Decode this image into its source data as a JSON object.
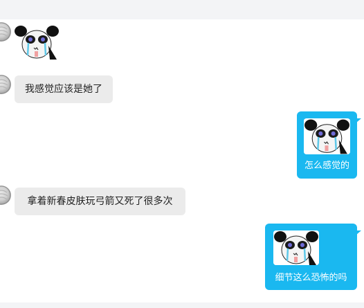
{
  "chat": {
    "messages": [
      {
        "direction": "incoming",
        "type": "sticker",
        "sticker_icon": "crying-panda-sticker"
      },
      {
        "direction": "incoming",
        "type": "text",
        "text": "我感觉应该是她了"
      },
      {
        "direction": "outgoing",
        "type": "sticker_caption",
        "sticker_icon": "crying-panda-sticker",
        "text": "怎么感觉的"
      },
      {
        "direction": "incoming",
        "type": "text",
        "text": "拿着新春皮肤玩弓箭又死了很多次"
      },
      {
        "direction": "outgoing",
        "type": "sticker_caption",
        "sticker_icon": "crying-panda-sticker",
        "text": "细节这么恐怖的吗"
      }
    ]
  },
  "colors": {
    "outgoing_bubble": "#1ab8f0",
    "incoming_bubble": "#ebebeb",
    "background": "#ffffff",
    "strip": "#f3f4f6"
  }
}
